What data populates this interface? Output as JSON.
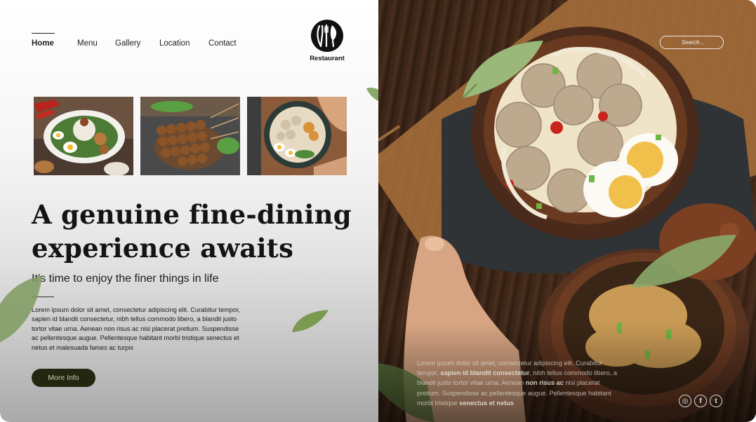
{
  "nav": {
    "items": [
      {
        "label": "Home",
        "active": true
      },
      {
        "label": "Menu"
      },
      {
        "label": "Gallery"
      },
      {
        "label": "Location"
      },
      {
        "label": "Contact"
      }
    ]
  },
  "logo": {
    "text": "Restaurant",
    "icon": "cutlery-leaf-icon"
  },
  "hero": {
    "headline_line1": "A genuine fine-dining",
    "headline_line2": "experience awaits",
    "subheading": "It’s time to enjoy the finer things in life",
    "body": "Lorem ipsum dolor sit amet, consectetur adipiscing elit. Curabitur tempor, sapien id blandit consectetur, nibh tellus commodo libero, a blandit justo tortor vitae urna. Aenean non risus ac nisi placerat pretium. Suspendisse ac pellentesque augue. Pellentesque habitant morbi tristique senectus et netus et malesuada fames ac turpis",
    "button_label": "More Info"
  },
  "search": {
    "placeholder": "Search..."
  },
  "right_text": {
    "part1": "Lorem ipsum dolor sit amet, consectetur adipiscing elit. Curabitur tempor, ",
    "bold1": "sapien id blandit consectetur",
    "part2": ", nibh tellus commodo libero, a blandit justo tortor vitae urna. Aenean ",
    "bold2": "non risus ac",
    "part3": " nisi placerat pretium. Suspendisse ac pellentesque augue. Pellentesque habitant morbi tristique ",
    "bold3": "senectus et netus"
  },
  "socials": [
    {
      "icon": "instagram-icon",
      "glyph": "◎"
    },
    {
      "icon": "facebook-icon",
      "glyph": "f"
    },
    {
      "icon": "twitter-icon",
      "glyph": "t"
    }
  ],
  "colors": {
    "accent": "#22280f",
    "button_text": "#c8c9b5"
  }
}
